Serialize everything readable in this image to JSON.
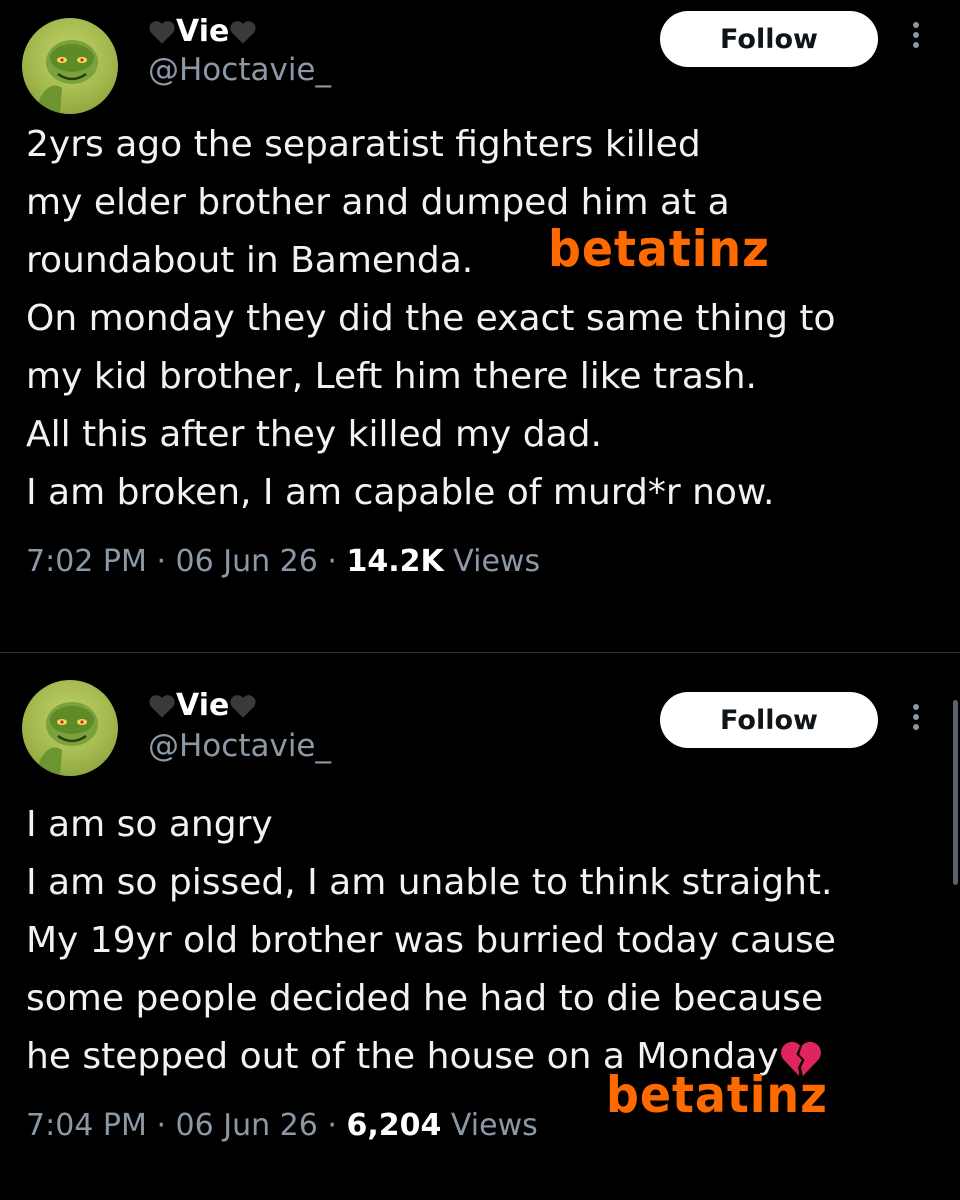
{
  "tweets": [
    {
      "user": {
        "display_name": "Vie",
        "handle": "@Hoctavie_"
      },
      "follow_label": "Follow",
      "lines": [
        "2yrs ago the separatist fighters killed",
        "my elder brother and dumped him at a",
        "roundabout in Bamenda.",
        "On monday they did the exact same thing to",
        "my kid brother, Left him there like trash.",
        "All this after they killed my dad.",
        "I am broken, I am capable of murd*r now."
      ],
      "time": "7:02 PM",
      "date": "06 Jun 26",
      "views_count": "14.2K",
      "views_label": "Views"
    },
    {
      "user": {
        "display_name": "Vie",
        "handle": "@Hoctavie_"
      },
      "follow_label": "Follow",
      "lines": [
        "I am so angry",
        "I am so pissed, I am unable to think straight.",
        "My 19yr old brother was burried today cause",
        "some people decided he had to die because",
        "he stepped out of the house on a Monday"
      ],
      "time": "7:04 PM",
      "date": "06 Jun 26",
      "views_count": "6,204",
      "views_label": "Views"
    }
  ],
  "separator": "·",
  "watermark_text": "betatinz",
  "icons": {
    "name_heart": "black-heart-icon",
    "more": "more-vertical-icon",
    "broken_heart": "broken-heart-icon"
  },
  "colors": {
    "background": "#000000",
    "text": "#e7e9ea",
    "muted": "#8b98a5",
    "watermark": "#ff6a00",
    "broken_heart": "#e0245e"
  }
}
